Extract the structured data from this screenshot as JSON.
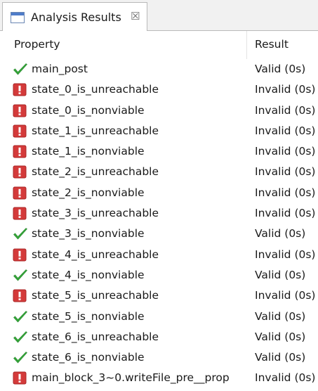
{
  "view": {
    "tab_title": "Analysis Results",
    "tab_icon": "view-window-icon",
    "close_glyph": "☒"
  },
  "columns": {
    "property": "Property",
    "result": "Result"
  },
  "colors": {
    "valid": "#35a83a",
    "invalid": "#d43a3a"
  },
  "rows": [
    {
      "status": "valid",
      "property": "main_post",
      "result": "Valid (0s)"
    },
    {
      "status": "invalid",
      "property": "state_0_is_unreachable",
      "result": "Invalid (0s)"
    },
    {
      "status": "invalid",
      "property": "state_0_is_nonviable",
      "result": "Invalid (0s)"
    },
    {
      "status": "invalid",
      "property": "state_1_is_unreachable",
      "result": "Invalid (0s)"
    },
    {
      "status": "invalid",
      "property": "state_1_is_nonviable",
      "result": "Invalid (0s)"
    },
    {
      "status": "invalid",
      "property": "state_2_is_unreachable",
      "result": "Invalid (0s)"
    },
    {
      "status": "invalid",
      "property": "state_2_is_nonviable",
      "result": "Invalid (0s)"
    },
    {
      "status": "invalid",
      "property": "state_3_is_unreachable",
      "result": "Invalid (0s)"
    },
    {
      "status": "valid",
      "property": "state_3_is_nonviable",
      "result": "Valid (0s)"
    },
    {
      "status": "invalid",
      "property": "state_4_is_unreachable",
      "result": "Invalid (0s)"
    },
    {
      "status": "valid",
      "property": "state_4_is_nonviable",
      "result": "Valid (0s)"
    },
    {
      "status": "invalid",
      "property": "state_5_is_unreachable",
      "result": "Invalid (0s)"
    },
    {
      "status": "valid",
      "property": "state_5_is_nonviable",
      "result": "Valid (0s)"
    },
    {
      "status": "valid",
      "property": "state_6_is_unreachable",
      "result": "Valid (0s)"
    },
    {
      "status": "valid",
      "property": "state_6_is_nonviable",
      "result": "Valid (0s)"
    },
    {
      "status": "invalid",
      "property": "main_block_3~0.writeFile_pre__prop",
      "result": "Invalid (0s)"
    }
  ]
}
